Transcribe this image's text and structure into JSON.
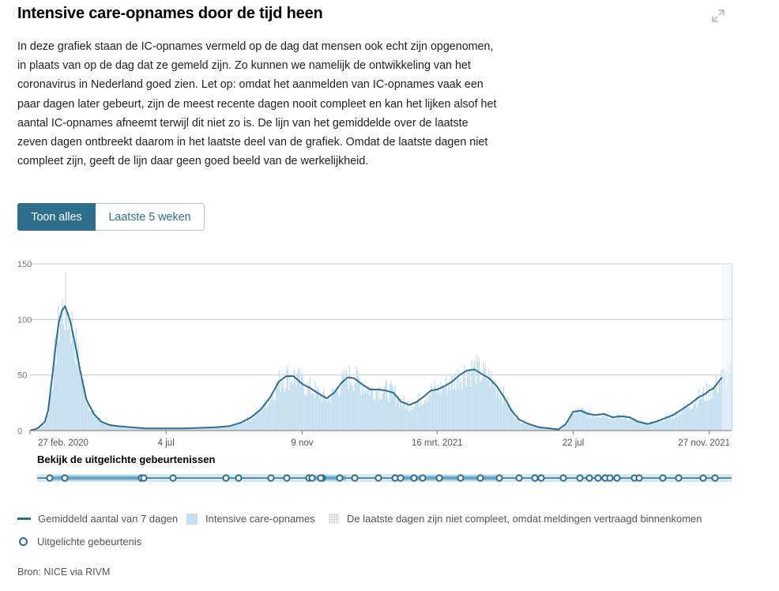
{
  "title": "Intensive care-opnames door de tijd heen",
  "description": "In deze grafiek staan de IC-opnames vermeld op de dag dat mensen ook echt zijn opgenomen, in plaats van op de dag dat ze gemeld zijn. Zo kunnen we namelijk de ontwikkeling van het coronavirus in Nederland goed zien. Let op: omdat het aanmelden van IC-opnames vaak een paar dagen later gebeurt, zijn de meest recente dagen nooit compleet en kan het lijken alsof het aantal IC-opnames afneemt terwijl dit niet zo is. De lijn van het gemiddelde over de laatste zeven dagen ontbreekt daarom in het laatste deel van de grafiek. Omdat de laatste dagen niet compleet zijn, geeft de lijn daar geen goed beeld van de werkelijkheid.",
  "tabs": {
    "active": "Toon alles",
    "inactive": "Laatste 5 weken"
  },
  "icons": {
    "expand": "expand-icon"
  },
  "events_title": "Bekijk de uitgelichte gebeurtenissen",
  "legend": {
    "avg": "Gemiddeld aantal van 7 dagen",
    "bars": "Intensive care-opnames",
    "incomplete": "De laatste dagen zijn niet compleet, omdat meldingen vertraagd binnenkomen",
    "events": "Uitgelichte gebeurtenis"
  },
  "source": "Bron: NICE via RIVM",
  "colors": {
    "line": "#2e6f8e",
    "bars": "#c6dff0",
    "accent": "#2e6f8e",
    "grid": "#c9c9c9"
  },
  "chart_data": {
    "type": "area",
    "x_range": [
      "2020-02-27",
      "2021-12-18"
    ],
    "ylim": [
      0,
      150
    ],
    "yticks": [
      0,
      50,
      100,
      150
    ],
    "xtick_labels": [
      "27 feb. 2020",
      "4 jul",
      "9 nov",
      "16 mrt. 2021",
      "22 jul",
      "27 nov. 2021"
    ],
    "legend_position": "bottom",
    "grid": true,
    "series": [
      {
        "name": "Gemiddeld aantal van 7 dagen",
        "kind": "line",
        "x": [
          "2020-02-27",
          "2020-03-05",
          "2020-03-12",
          "2020-03-15",
          "2020-03-19",
          "2020-03-22",
          "2020-03-25",
          "2020-03-28",
          "2020-03-31",
          "2020-04-05",
          "2020-04-10",
          "2020-04-15",
          "2020-04-20",
          "2020-04-27",
          "2020-05-04",
          "2020-05-12",
          "2020-05-20",
          "2020-06-01",
          "2020-06-15",
          "2020-07-04",
          "2020-07-20",
          "2020-08-05",
          "2020-08-20",
          "2020-09-01",
          "2020-09-12",
          "2020-09-22",
          "2020-10-01",
          "2020-10-10",
          "2020-10-18",
          "2020-10-25",
          "2020-11-01",
          "2020-11-09",
          "2020-11-17",
          "2020-11-25",
          "2020-12-02",
          "2020-12-09",
          "2020-12-16",
          "2020-12-22",
          "2020-12-28",
          "2021-01-04",
          "2021-01-12",
          "2021-01-20",
          "2021-01-27",
          "2021-02-03",
          "2021-02-10",
          "2021-02-18",
          "2021-02-25",
          "2021-03-04",
          "2021-03-10",
          "2021-03-16",
          "2021-03-23",
          "2021-03-30",
          "2021-04-06",
          "2021-04-13",
          "2021-04-20",
          "2021-04-27",
          "2021-05-04",
          "2021-05-11",
          "2021-05-18",
          "2021-05-25",
          "2021-06-01",
          "2021-06-10",
          "2021-06-20",
          "2021-06-30",
          "2021-07-08",
          "2021-07-15",
          "2021-07-22",
          "2021-07-29",
          "2021-08-05",
          "2021-08-12",
          "2021-08-20",
          "2021-08-28",
          "2021-09-05",
          "2021-09-13",
          "2021-09-21",
          "2021-09-30",
          "2021-10-08",
          "2021-10-16",
          "2021-10-24",
          "2021-11-01",
          "2021-11-09",
          "2021-11-17",
          "2021-11-23",
          "2021-11-27",
          "2021-12-01",
          "2021-12-05",
          "2021-12-09"
        ],
        "values": [
          0,
          2,
          8,
          18,
          50,
          75,
          97,
          108,
          112,
          98,
          75,
          50,
          28,
          15,
          8,
          5,
          4,
          3,
          2,
          2,
          2,
          2.5,
          3,
          4,
          7,
          12,
          19,
          30,
          44,
          49,
          49,
          42,
          38,
          33,
          29,
          34,
          43,
          48,
          47,
          42,
          37,
          37,
          36,
          34,
          26,
          23,
          26,
          31,
          36,
          37,
          40,
          44,
          50,
          54,
          55,
          51,
          47,
          40,
          30,
          18,
          10,
          6,
          3,
          2,
          1,
          6,
          17,
          18,
          15,
          14,
          15,
          12,
          13,
          12,
          8,
          6,
          8,
          11,
          14,
          19,
          24,
          30,
          33,
          36,
          38,
          43,
          48
        ]
      },
      {
        "name": "Intensive care-opnames",
        "kind": "bar",
        "note": "daily admissions, scattered around the 7-day average; peaks about 125 (spring 2020) and about 150 on the last day"
      }
    ],
    "events_count": 40
  }
}
